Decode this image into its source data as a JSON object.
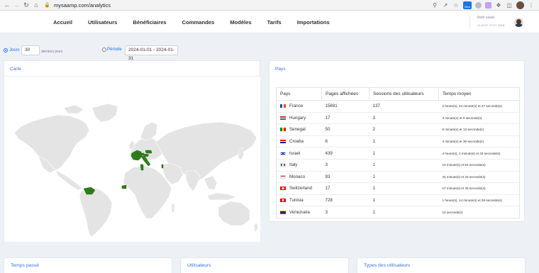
{
  "browser": {
    "url": "mysaamp.com/analytics",
    "new_badge": "New"
  },
  "header": {
    "nav": [
      "Accueil",
      "Utilisateurs",
      "Bénéficiaires",
      "Commandes",
      "Modèles",
      "Tarifs",
      "Importations"
    ],
    "user_name": "iheb saad",
    "user_role": "CLIENT TEST WEB"
  },
  "filters": {
    "jours_label": "Jours",
    "jours_value": "30",
    "jours_suffix": "derniers jours",
    "jours_checked": true,
    "periode_label": "Période",
    "periode_value": "2024-01-01 - 2024-01-31",
    "periode_checked": false
  },
  "map_card": {
    "title": "Carte",
    "highlight_color": "#2e7d1b",
    "base_color": "#e4e4e4"
  },
  "pays_card": {
    "title": "Pays",
    "columns": [
      "Pays",
      "Pages affichées",
      "Sessions des utilisateurs",
      "Temps moyen"
    ],
    "rows": [
      {
        "country": "France",
        "pages": "15691",
        "sessions": "137",
        "time": "2 heure(s), 44 minute(s) et 37 seconde(s)",
        "flag": "fr"
      },
      {
        "country": "Hungary",
        "pages": "17",
        "sessions": "3",
        "time": "3 minute(s) et 9 seconde(s)",
        "flag": "hu"
      },
      {
        "country": "Senegal",
        "pages": "50",
        "sessions": "2",
        "time": "6 minute(s) et 13 seconde(s)",
        "flag": "sn"
      },
      {
        "country": "Croatia",
        "pages": "6",
        "sessions": "1",
        "time": "4 minute(s) et 39 seconde(s)",
        "flag": "hr"
      },
      {
        "country": "Israel",
        "pages": "439",
        "sessions": "1",
        "time": "4 heure(s), 2 minute(s) et 43 seconde(s)",
        "flag": "il"
      },
      {
        "country": "Italy",
        "pages": "3",
        "sessions": "1",
        "time": "10 minute(s) et 54 seconde(s)",
        "flag": "it"
      },
      {
        "country": "Monaco",
        "pages": "93",
        "sessions": "1",
        "time": "44 minute(s) et 33 seconde(s)",
        "flag": "mc"
      },
      {
        "country": "Switzerland",
        "pages": "17",
        "sessions": "1",
        "time": "17 minute(s) et 36 seconde(s)",
        "flag": "ch"
      },
      {
        "country": "Tunisia",
        "pages": "728",
        "sessions": "1",
        "time": "1 heure(s), 14 minute(s) et 28 seconde(s)",
        "flag": "tn"
      },
      {
        "country": "Venezuela",
        "pages": "3",
        "sessions": "1",
        "time": "13 seconde(s)",
        "flag": "ve"
      }
    ]
  },
  "bottom_cards": [
    "Temps passé",
    "Utilisateurs",
    "Types des utilisateurs"
  ]
}
